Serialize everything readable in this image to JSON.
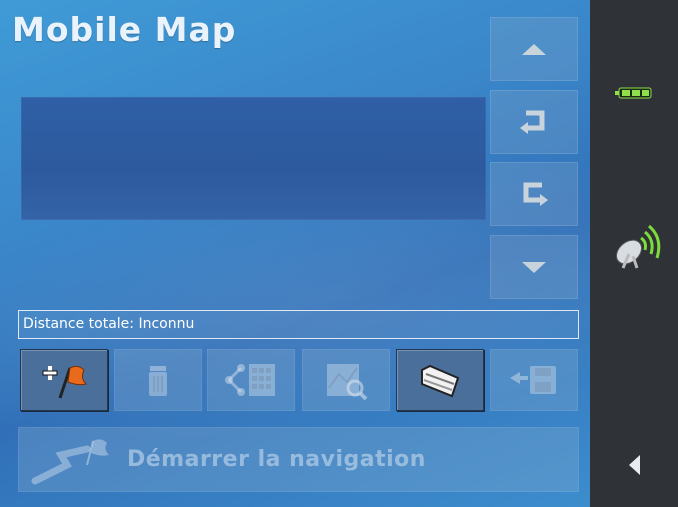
{
  "app": {
    "title": "Mobile Map"
  },
  "route": {
    "distance_text": "Distance totale: Inconnu"
  },
  "navigation": {
    "start_label": "Démarrer la navigation"
  },
  "side_buttons": [
    {
      "name": "scroll-up-button",
      "icon": "triangle-up-icon"
    },
    {
      "name": "move-back-button",
      "icon": "return-left-icon"
    },
    {
      "name": "move-forward-button",
      "icon": "return-right-icon"
    },
    {
      "name": "scroll-down-button",
      "icon": "triangle-down-icon"
    }
  ],
  "toolbar": [
    {
      "name": "add-waypoint-button",
      "icon": "flag-plus-icon",
      "enabled": true
    },
    {
      "name": "delete-button",
      "icon": "trash-icon",
      "enabled": false
    },
    {
      "name": "route-calc-button",
      "icon": "route-calculator-icon",
      "enabled": false
    },
    {
      "name": "map-search-button",
      "icon": "map-magnifier-icon",
      "enabled": false
    },
    {
      "name": "open-folder-button",
      "icon": "folder-icon",
      "enabled": true
    },
    {
      "name": "save-route-button",
      "icon": "save-disk-icon",
      "enabled": false
    }
  ],
  "status": {
    "battery_icon": "battery-icon",
    "gps_icon": "satellite-dish-icon"
  },
  "colors": {
    "accent": "#3a86c9",
    "panel": "#2f3338",
    "battery": "#8fe04a",
    "gps": "#7ddc3a"
  }
}
